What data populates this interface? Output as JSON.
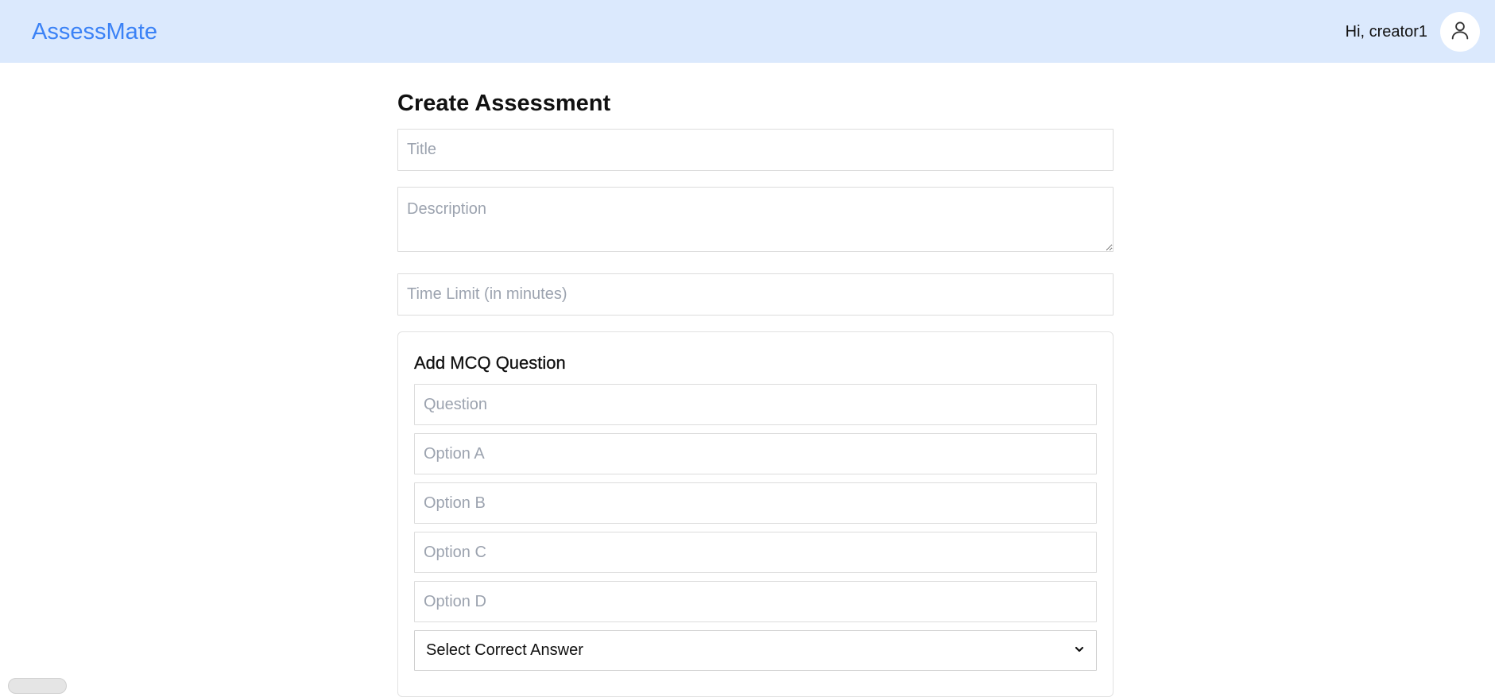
{
  "header": {
    "brand": "AssessMate",
    "greeting": "Hi, creator1",
    "avatar_icon": "user-icon",
    "background": "#dbe9fd",
    "brand_color": "#3b82f6"
  },
  "form": {
    "title": "Create Assessment",
    "title_placeholder": "Title",
    "description_placeholder": "Description",
    "time_limit_placeholder": "Time Limit (in minutes)"
  },
  "mcq": {
    "heading": "Add MCQ Question",
    "question_placeholder": "Question",
    "options": [
      {
        "placeholder": "Option A"
      },
      {
        "placeholder": "Option B"
      },
      {
        "placeholder": "Option C"
      },
      {
        "placeholder": "Option D"
      }
    ],
    "correct_answer": {
      "selected": "Select Correct Answer",
      "icon": "chevron-down-icon"
    }
  }
}
